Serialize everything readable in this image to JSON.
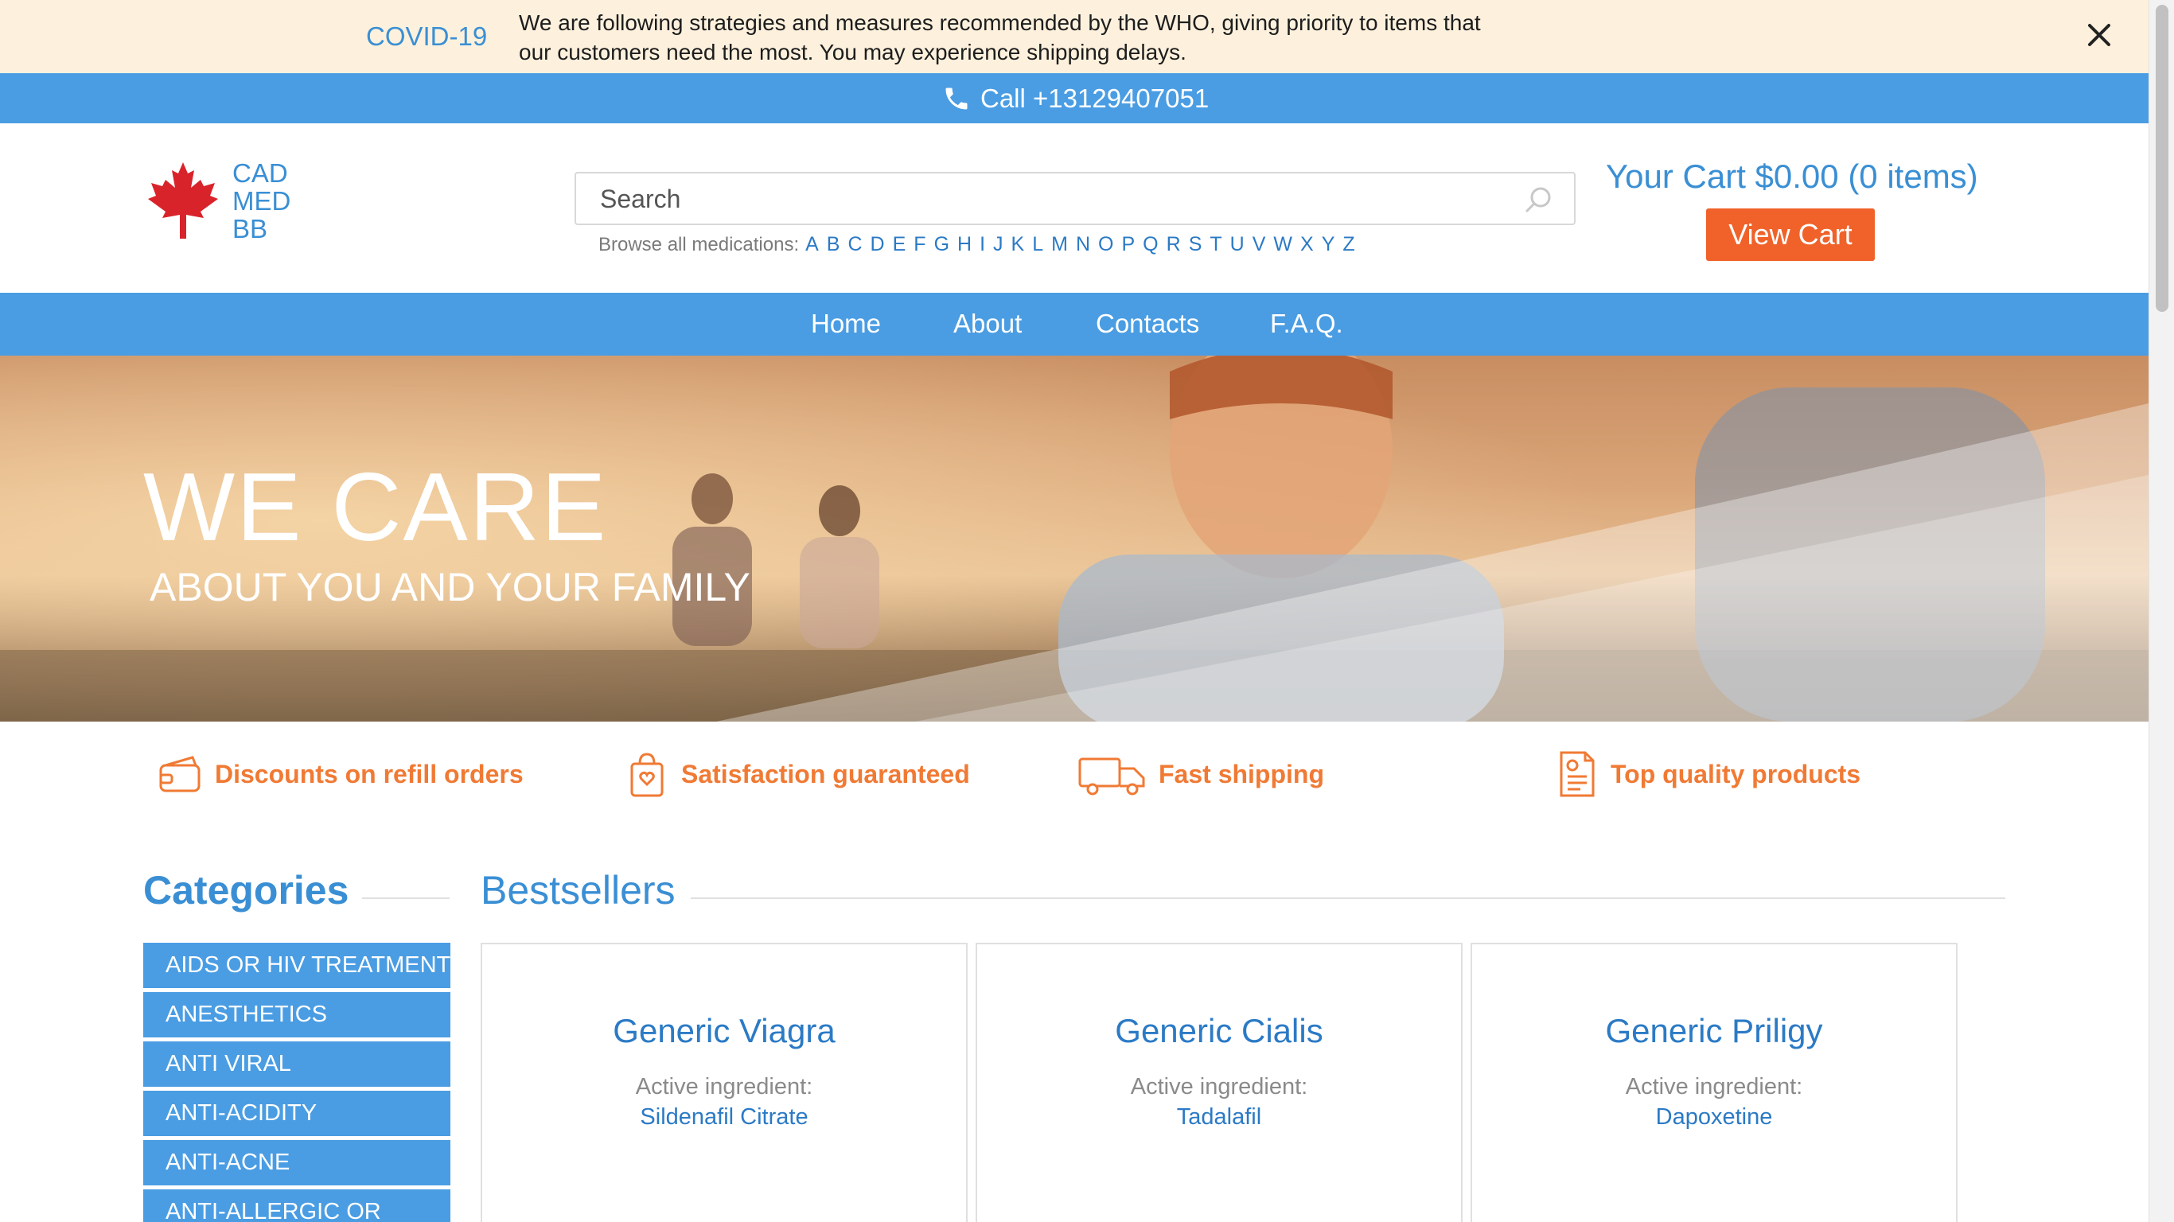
{
  "covid": {
    "title": "COVID-19",
    "message": "We are following strategies and measures recommended by the WHO, giving priority to items that our customers need the most. You may experience shipping delays."
  },
  "call": {
    "label": "Call +13129407051"
  },
  "brand": {
    "line1": "CAD",
    "line2": "MED",
    "line3": "BB",
    "accent": "#d9232a"
  },
  "search": {
    "placeholder": "Search",
    "browse_label": "Browse all medications:",
    "letters": [
      "A",
      "B",
      "C",
      "D",
      "E",
      "F",
      "G",
      "H",
      "I",
      "J",
      "K",
      "L",
      "M",
      "N",
      "O",
      "P",
      "Q",
      "R",
      "S",
      "T",
      "U",
      "V",
      "W",
      "X",
      "Y",
      "Z"
    ]
  },
  "cart": {
    "summary": "Your Cart $0.00 (0 items)",
    "button": "View Cart"
  },
  "nav": {
    "items": [
      "Home",
      "About",
      "Contacts",
      "F.A.Q."
    ]
  },
  "hero": {
    "title": "WE CARE",
    "subtitle": "ABOUT YOU AND YOUR FAMILY"
  },
  "features": [
    {
      "label": "Discounts on refill orders",
      "icon": "wallet-icon"
    },
    {
      "label": "Satisfaction guaranteed",
      "icon": "shopping-bag-heart-icon"
    },
    {
      "label": "Fast shipping",
      "icon": "truck-icon"
    },
    {
      "label": "Top quality products",
      "icon": "certificate-icon"
    }
  ],
  "categories": {
    "heading": "Categories",
    "items": [
      "AIDS OR HIV TREATMENT",
      "ANESTHETICS",
      "ANTI VIRAL",
      "ANTI-ACIDITY",
      "ANTI-ACNE",
      "ANTI-ALLERGIC OR"
    ]
  },
  "bestsellers": {
    "heading": "Bestsellers",
    "ingredient_label": "Active ingredient:",
    "products": [
      {
        "name": "Generic Viagra",
        "ingredient": "Sildenafil Citrate"
      },
      {
        "name": "Generic Cialis",
        "ingredient": "Tadalafil"
      },
      {
        "name": "Generic Priligy",
        "ingredient": "Dapoxetine"
      }
    ]
  },
  "colors": {
    "primary_blue": "#4a9de3",
    "link_blue": "#2b7ac5",
    "orange": "#f0622a",
    "feature_orange": "#f07a34",
    "banner_bg": "#fdf1dd"
  }
}
